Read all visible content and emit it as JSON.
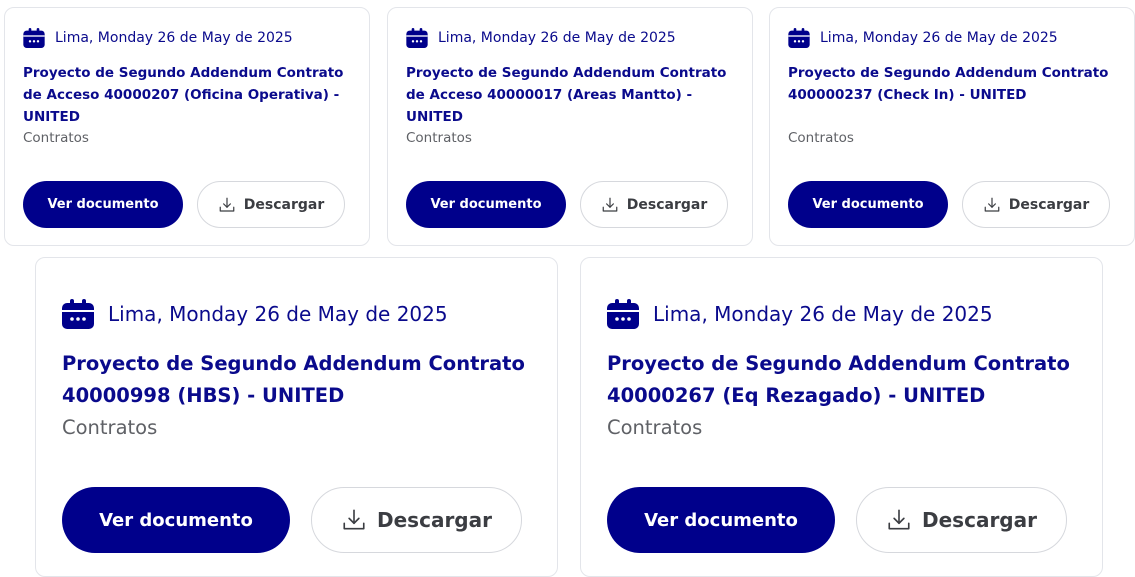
{
  "colors": {
    "accent": "#00008b",
    "title": "#0a0a8c",
    "muted": "#5f6166",
    "border": "#e3e5ea"
  },
  "icons": {
    "date": "calendar-icon",
    "download": "download-icon"
  },
  "cards": [
    {
      "date": "Lima, Monday 26 de May de 2025",
      "title": "Proyecto de Segundo Addendum Contrato de Acceso 40000207 (Oficina Operativa) - UNITED",
      "category": "Contratos",
      "view_label": "Ver documento",
      "download_label": "Descargar"
    },
    {
      "date": "Lima, Monday 26 de May de 2025",
      "title": "Proyecto de Segundo Addendum Contrato de Acceso 40000017 (Areas Mantto) - UNITED",
      "category": "Contratos",
      "view_label": "Ver documento",
      "download_label": "Descargar"
    },
    {
      "date": "Lima, Monday 26 de May de 2025",
      "title": "Proyecto de Segundo Addendum Contrato 400000237 (Check In) - UNITED",
      "category": "Contratos",
      "view_label": "Ver documento",
      "download_label": "Descargar"
    },
    {
      "date": "Lima, Monday 26 de May de 2025",
      "title": "Proyecto de Segundo Addendum Contrato 40000998 (HBS) - UNITED",
      "category": "Contratos",
      "view_label": "Ver documento",
      "download_label": "Descargar"
    },
    {
      "date": "Lima, Monday 26 de May de 2025",
      "title": "Proyecto de Segundo Addendum Contrato 40000267 (Eq Rezagado) - UNITED",
      "category": "Contratos",
      "view_label": "Ver documento",
      "download_label": "Descargar"
    }
  ]
}
